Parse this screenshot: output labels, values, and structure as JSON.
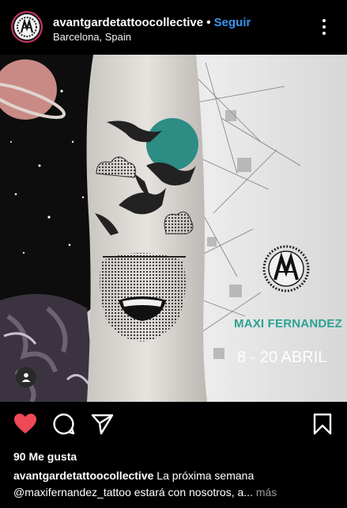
{
  "header": {
    "username": "avantgardetattoocollective",
    "separator": "•",
    "follow_label": "Seguir",
    "location": "Barcelona, Spain",
    "avatar_icon": "studio-logo-icon",
    "menu_icon": "more-vertical-icon"
  },
  "post": {
    "artist_name": "MAXI FERNANDEZ",
    "dates": "8 - 20 ABRIL",
    "tag_icon": "user-tag-icon"
  },
  "actions": {
    "like_icon": "heart-filled-icon",
    "comment_icon": "comment-icon",
    "share_icon": "send-icon",
    "save_icon": "bookmark-icon",
    "liked": true
  },
  "likes": {
    "text": "90 Me gusta"
  },
  "caption": {
    "username": "avantgardetattoocollective",
    "line1": "La próxima semana",
    "line2": "@maxifernandez_tattoo estará con nosotros, a...",
    "more_label": "más"
  },
  "colors": {
    "follow": "#3d95f0",
    "like": "#ed4956",
    "accent_teal": "#2aa294",
    "avatar_ring": "#c6346a"
  }
}
